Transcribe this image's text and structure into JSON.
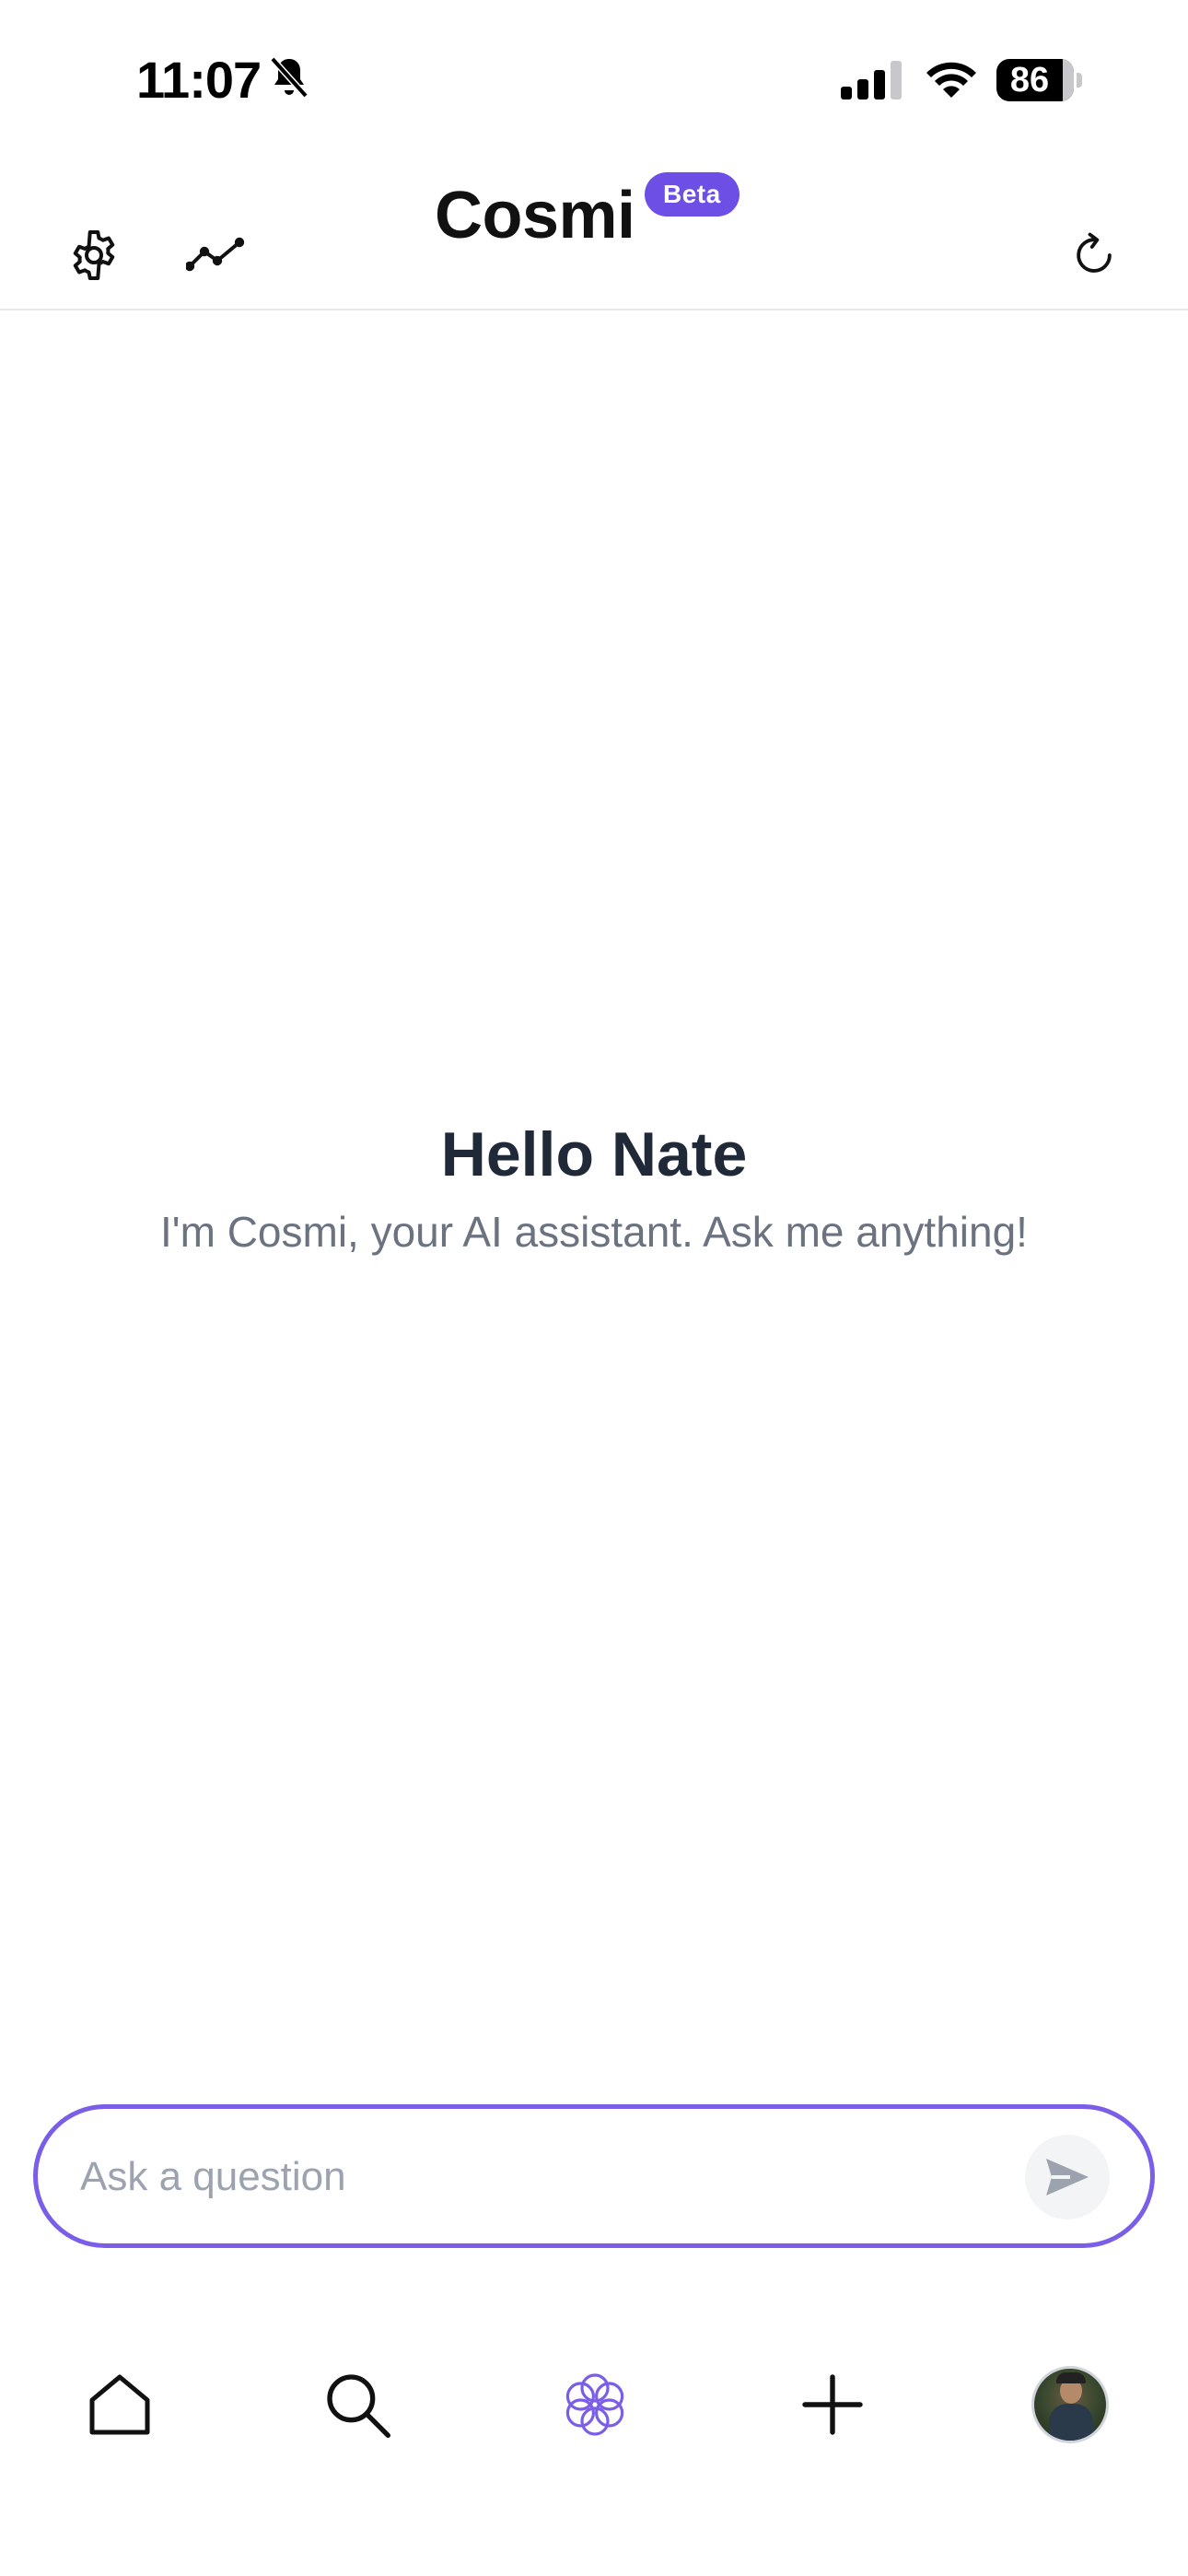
{
  "status_bar": {
    "time": "11:07",
    "battery": "86",
    "icons": [
      "bell-slash-icon",
      "cellular-signal-icon",
      "wifi-icon",
      "battery-icon"
    ]
  },
  "header": {
    "title": "Cosmi",
    "badge": "Beta",
    "left_icons": [
      "gear-icon",
      "trend-line-icon"
    ],
    "right_icon": "refresh-icon"
  },
  "greeting": {
    "title": "Hello Nate",
    "subtitle": "I'm Cosmi, your AI assistant. Ask me anything!"
  },
  "composer": {
    "placeholder": "Ask a question",
    "value": "",
    "send_icon": "send-arrow-icon"
  },
  "bottom_nav": {
    "items": [
      "home-icon",
      "search-icon",
      "cosmi-flower-icon",
      "plus-icon",
      "profile-avatar"
    ]
  },
  "colors": {
    "accent": "#6d4fe6",
    "input_border": "#7b5ee8",
    "text_primary": "#1f2937",
    "text_secondary": "#6b7280",
    "placeholder": "#9ca3af"
  }
}
